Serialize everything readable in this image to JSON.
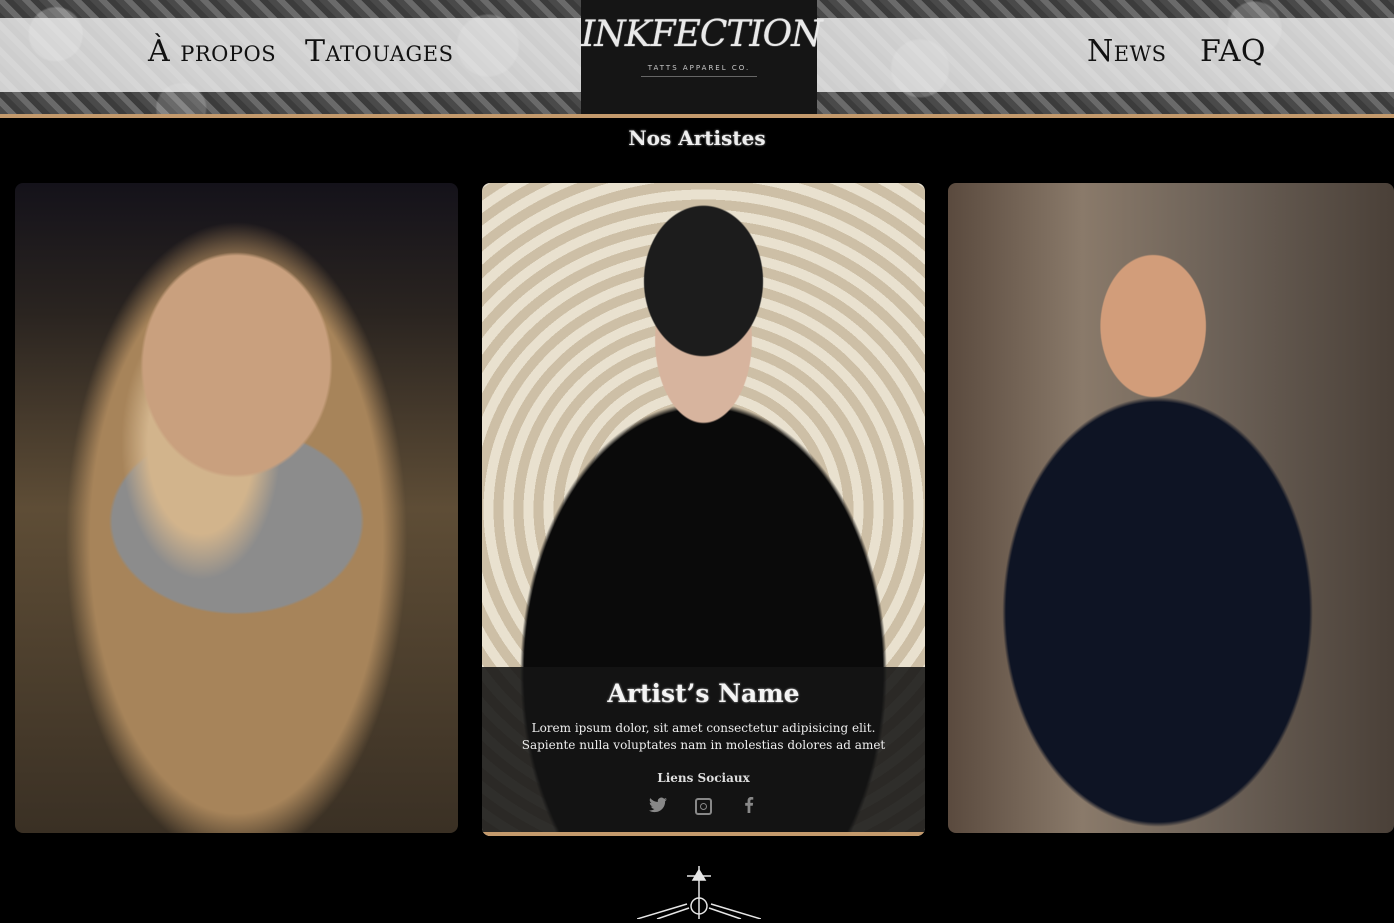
{
  "header": {
    "nav_left": [
      "À propos",
      "Tatouages"
    ],
    "nav_right": [
      "News",
      "FAQ"
    ],
    "logo": {
      "name": "INKFECTION",
      "subtitle": "TATTS APPAREL CO."
    },
    "accent_color": "#c49a6c"
  },
  "section": {
    "title": "Nos Artistes"
  },
  "cards": [
    {
      "photo": "artist-woman-photo"
    },
    {
      "photo": "artist-man-cap-photo",
      "name": "Artist’s Name",
      "description_line1": "Lorem ipsum dolor, sit amet consectetur adipisicing elit.",
      "description_line2": "Sapiente nulla voluptates nam in molestias dolores ad amet",
      "social_title": "Liens Sociaux",
      "social_icons": [
        "twitter-icon",
        "instagram-icon",
        "facebook-icon"
      ]
    },
    {
      "photo": "artist-man-smiling-photo"
    }
  ],
  "footer": {
    "emblem": "dagger-emblem-icon"
  }
}
